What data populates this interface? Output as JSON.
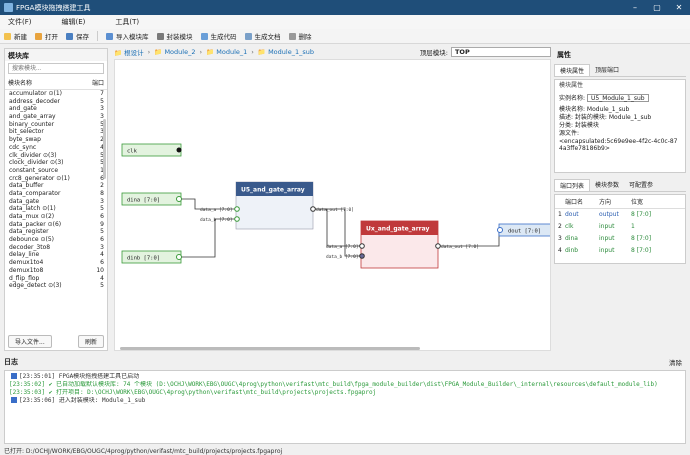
{
  "window": {
    "title": "FPGA模块拖拽搭建工具"
  },
  "menu": [
    "文件(F)",
    "编辑(E)",
    "工具(T)"
  ],
  "toolbar": [
    {
      "label": "新建",
      "color": "#f2c14e"
    },
    {
      "label": "打开",
      "color": "#e8a33d"
    },
    {
      "label": "保存",
      "color": "#4a7fc1"
    },
    {
      "label": "导入模块库",
      "color": "#5b8fd1"
    },
    {
      "label": "封装模块",
      "color": "#7a7a7a"
    },
    {
      "label": "生成代码",
      "color": "#6a9fd8"
    },
    {
      "label": "生成文档",
      "color": "#7aa0c8"
    },
    {
      "label": "删除",
      "color": "#999999"
    }
  ],
  "library": {
    "title": "模块库",
    "search_placeholder": "搜索模块...",
    "col_name": "模块名称",
    "col_ports": "端口",
    "items": [
      {
        "name": "accumulator ⊙(1)",
        "ports": "7"
      },
      {
        "name": "address_decoder",
        "ports": "5"
      },
      {
        "name": "and_gate",
        "ports": "3"
      },
      {
        "name": "and_gate_array",
        "ports": "3"
      },
      {
        "name": "binary_counter",
        "ports": "5"
      },
      {
        "name": "bit_selector",
        "ports": "3"
      },
      {
        "name": "byte_swap",
        "ports": "2"
      },
      {
        "name": "cdc_sync",
        "ports": "4"
      },
      {
        "name": "clk_divider ⊙(3)",
        "ports": "5"
      },
      {
        "name": "clock_divider ⊙(3)",
        "ports": "5"
      },
      {
        "name": "constant_source",
        "ports": "1"
      },
      {
        "name": "crc8_generator ⊙(1)",
        "ports": "6"
      },
      {
        "name": "data_buffer",
        "ports": "2"
      },
      {
        "name": "data_comparator",
        "ports": "8"
      },
      {
        "name": "data_gate",
        "ports": "3"
      },
      {
        "name": "data_latch ⊙(1)",
        "ports": "5"
      },
      {
        "name": "data_mux ⊙(2)",
        "ports": "6"
      },
      {
        "name": "data_packer ⊙(6)",
        "ports": "9"
      },
      {
        "name": "data_register",
        "ports": "5"
      },
      {
        "name": "debounce ⊙(5)",
        "ports": "6"
      },
      {
        "name": "decoder_3to8",
        "ports": "3"
      },
      {
        "name": "delay_line",
        "ports": "4"
      },
      {
        "name": "demux1to4",
        "ports": "6"
      },
      {
        "name": "demux1to8",
        "ports": "10"
      },
      {
        "name": "d_flip_flop",
        "ports": "4"
      },
      {
        "name": "edge_detect ⊙(3)",
        "ports": "5"
      }
    ],
    "import_label": "导入文件...",
    "refresh_label": "刷新"
  },
  "breadcrumb": {
    "items": [
      "根设计",
      "Module_2",
      "Module_1",
      "Module_1_sub"
    ],
    "top_label": "顶层模块:",
    "top_value": "TOP"
  },
  "canvas": {
    "inputs": [
      {
        "label": "clk"
      },
      {
        "label": "dina [7:0]"
      },
      {
        "label": "dinb [7:0]"
      }
    ],
    "output": {
      "label": "dout [7:0]"
    },
    "block1": {
      "title": "U5_and_gate_array",
      "port_a": "data_a [7:0]",
      "port_b": "data_b [7:0]",
      "port_out": "data_out [7:0]",
      "color": "#3a5a8c"
    },
    "block2": {
      "title": "Ux_and_gate_array",
      "port_a": "data_a [7:0]",
      "port_b": "data_b [7:0]",
      "port_out": "data_out [7:0]",
      "color": "#c0393b"
    }
  },
  "properties": {
    "title": "属性",
    "tabs": [
      "模块属性",
      "顶层端口"
    ],
    "group": "模块属性",
    "instance_label": "实例名称:",
    "instance_value": "U5_Module_1_sub",
    "module_name": "模块名称: Module_1_sub",
    "desc": "描述: 封装的模块: Module_1_sub",
    "category": "分类: 封装模块",
    "source_label": "源文件:",
    "source_value": "<encapsulated:5c69e9ee-4f2c-4c0c-874a3ffe78186b9>",
    "port_tabs": [
      "端口列表",
      "模块参数",
      "可配置参"
    ],
    "port_cols": [
      "",
      "端口名",
      "方向",
      "位宽"
    ],
    "ports": [
      {
        "idx": "1",
        "name": "dout",
        "dir": "output",
        "width": "8 [7:0]"
      },
      {
        "idx": "2",
        "name": "clk",
        "dir": "input",
        "width": "1"
      },
      {
        "idx": "3",
        "name": "dina",
        "dir": "input",
        "width": "8 [7:0]"
      },
      {
        "idx": "4",
        "name": "dinb",
        "dir": "input",
        "width": "8 [7:0]"
      }
    ]
  },
  "log": {
    "title": "日志",
    "clear_label": "清除",
    "lines": [
      {
        "text": "[23:35:01]  FPGA模块拖拽搭建工具已启动",
        "color": "#333333",
        "mark": "#3a6ec8"
      },
      {
        "text": "[23:35:02] ✔ 已自动加载默认模块库: 74 个模块 (D:\\OCHJ\\WORK\\EBG\\OUGC\\4prog\\python\\verifast\\mtc_build\\fpga_module_builder\\dist\\FPGA_Module_Builder\\_internal\\resources\\default_module_lib)",
        "color": "#2a9a3a",
        "mark": ""
      },
      {
        "text": "[23:35:03] ✔ 打开项目: D:\\OCHJ\\WORK\\EBG\\OUGC\\4prog\\python\\verifast\\mtc_build\\projects\\projects.fpgaproj",
        "color": "#2a9a3a",
        "mark": ""
      },
      {
        "text": "[23:35:06]  进入封装模块: Module_1_sub",
        "color": "#333333",
        "mark": "#3a6ec8"
      }
    ]
  },
  "status": "已打开: D:/OCHJ/WORK/EBG/OUGC/4prog/python/verifast/mtc_build/projects/projects.fpgaproj"
}
